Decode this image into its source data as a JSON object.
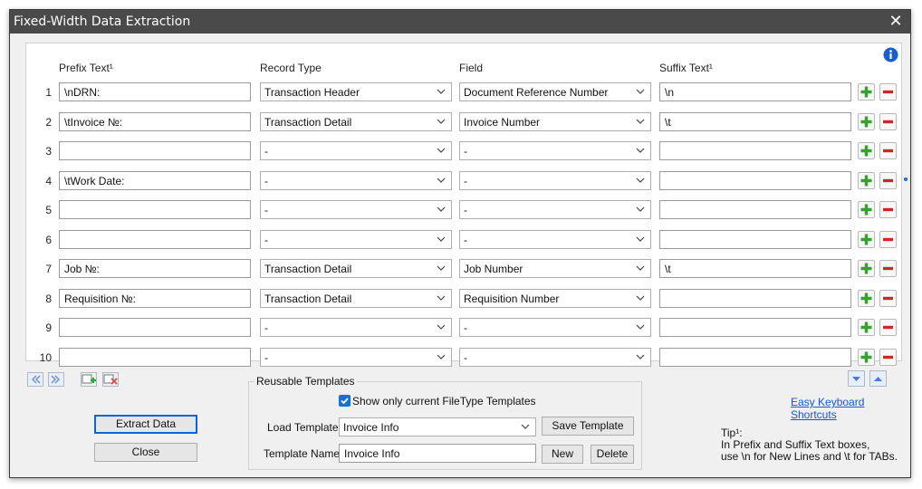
{
  "window": {
    "title": "Fixed-Width Data Extraction",
    "close_glyph": "✕"
  },
  "columns": {
    "prefix": "Prefix Text¹",
    "record_type": "Record Type",
    "field": "Field",
    "suffix": "Suffix Text¹"
  },
  "rows": [
    {
      "num": "1",
      "prefix": "\\nDRN:",
      "record_type": "Transaction Header",
      "field": "Document Reference Number",
      "suffix": "\\n"
    },
    {
      "num": "2",
      "prefix": "\\tInvoice №:",
      "record_type": "Transaction Detail",
      "field": "Invoice Number",
      "suffix": "\\t"
    },
    {
      "num": "3",
      "prefix": "",
      "record_type": "-",
      "field": "-",
      "suffix": ""
    },
    {
      "num": "4",
      "prefix": "\\tWork Date:",
      "record_type": "-",
      "field": "-",
      "suffix": ""
    },
    {
      "num": "5",
      "prefix": "",
      "record_type": "-",
      "field": "-",
      "suffix": ""
    },
    {
      "num": "6",
      "prefix": "",
      "record_type": "-",
      "field": "-",
      "suffix": ""
    },
    {
      "num": "7",
      "prefix": "Job №:",
      "record_type": "Transaction Detail",
      "field": "Job Number",
      "suffix": "\\t"
    },
    {
      "num": "8",
      "prefix": "Requisition №:",
      "record_type": "Transaction Detail",
      "field": "Requisition Number",
      "suffix": ""
    },
    {
      "num": "9",
      "prefix": "",
      "record_type": "-",
      "field": "-",
      "suffix": ""
    },
    {
      "num": "10",
      "prefix": "",
      "record_type": "-",
      "field": "-",
      "suffix": ""
    }
  ],
  "templates": {
    "legend": "Reusable Templates",
    "show_only_label": "Show only current FileType Templates",
    "show_only_checked": true,
    "load_label": "Load Template:",
    "load_value": "Invoice Info",
    "name_label": "Template Name:",
    "name_value": "Invoice Info",
    "save_button": "Save Template",
    "new_button": "New",
    "delete_button": "Delete"
  },
  "buttons": {
    "extract": "Extract Data",
    "close": "Close"
  },
  "shortcuts_link": "Easy Keyboard Shortcuts",
  "tip": {
    "title": "Tip¹:",
    "line1": "In Prefix and Suffix Text boxes,",
    "line2": "use \\n for New Lines and \\t for TABs."
  },
  "colors": {
    "accent": "#1a6fd6",
    "add_green": "#2fa52f",
    "remove_red": "#c82828",
    "titlebar": "#4a4a4a"
  }
}
